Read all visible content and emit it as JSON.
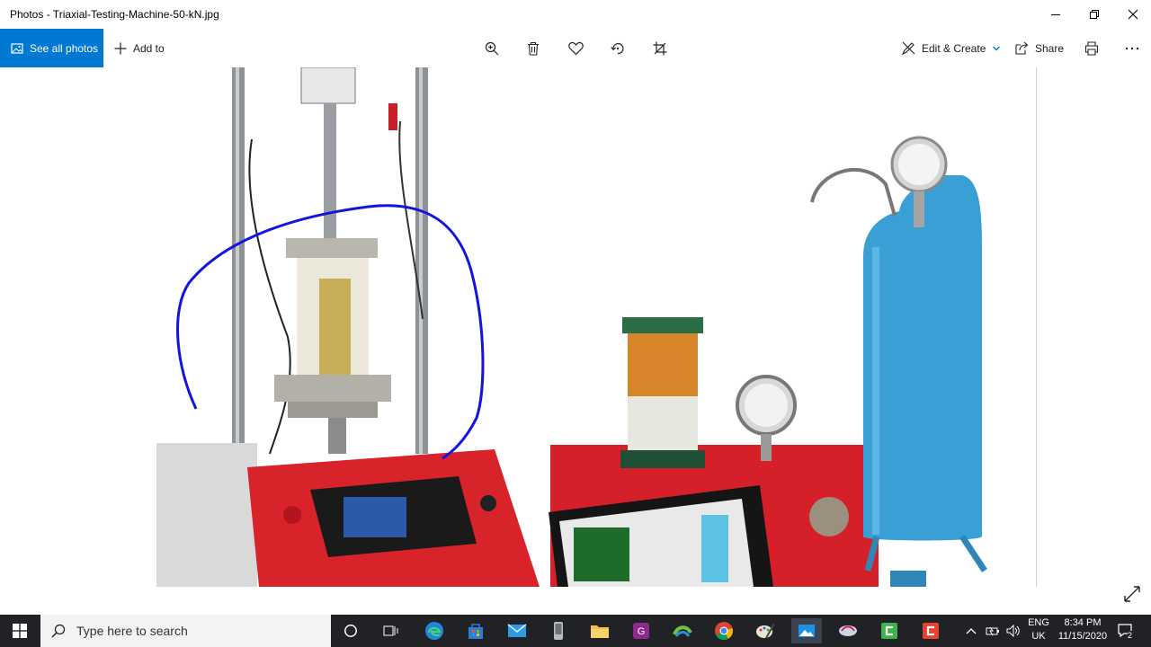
{
  "window": {
    "title": "Photos - Triaxial-Testing-Machine-50-kN.jpg",
    "controls": [
      "minimize-icon",
      "restore-icon",
      "close-icon"
    ]
  },
  "toolbar": {
    "see_all_label": "See all photos",
    "add_to_label": "Add to",
    "center_icons": [
      "zoom-in-icon",
      "delete-icon",
      "heart-icon",
      "rotate-icon",
      "crop-icon"
    ],
    "edit_create_label": "Edit & Create",
    "share_label": "Share",
    "accent_color": "#0078d4"
  },
  "photo": {
    "subject_colors": {
      "machine_red": "#d81f26",
      "tank_blue": "#3a9fd4",
      "annotation_blue": "#1414e0"
    }
  },
  "taskbar": {
    "search_placeholder": "Type here to search",
    "apps": [
      "cortana-icon",
      "task-view-icon",
      "edge-icon",
      "store-icon",
      "mail-icon",
      "phone-icon",
      "file-explorer-icon",
      "pdf-icon",
      "maps-icon",
      "chrome-icon",
      "paint-icon",
      "photos-icon",
      "app-icon",
      "camtasia-icon",
      "recorder-icon"
    ],
    "lang_top": "ENG",
    "lang_bottom": "UK",
    "time": "8:34 PM",
    "date": "11/15/2020",
    "notification_count": "2"
  }
}
